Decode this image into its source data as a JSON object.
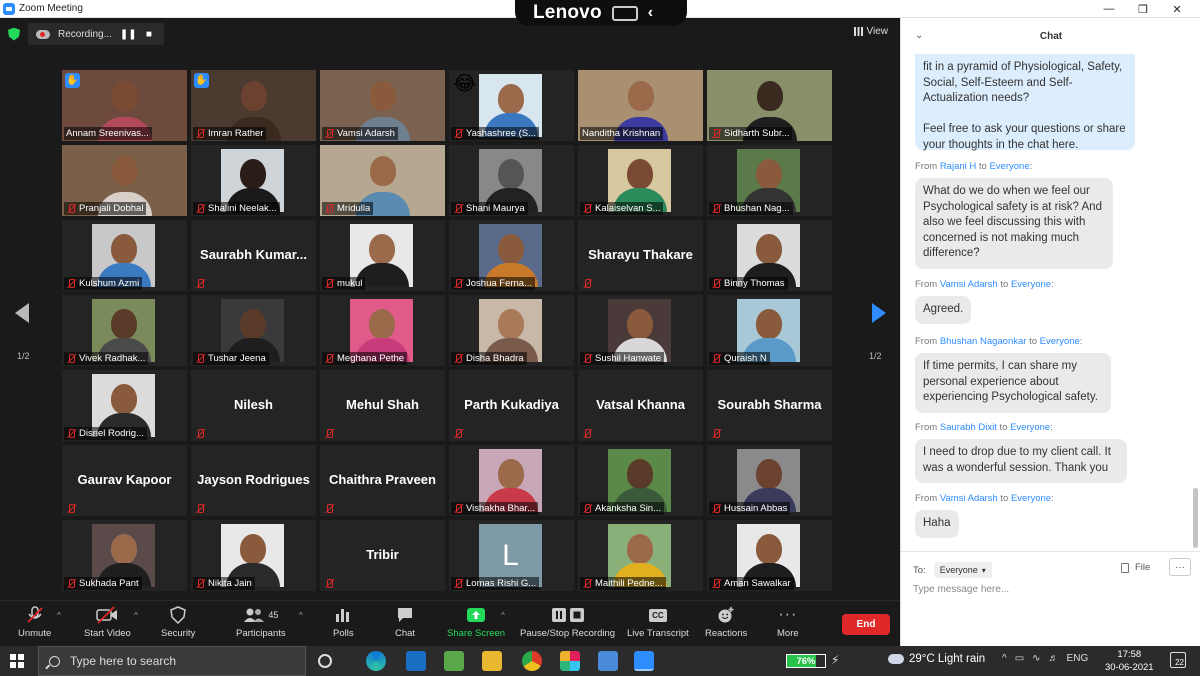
{
  "window": {
    "title": "Zoom Meeting"
  },
  "overlay": {
    "brand": "Lenovo"
  },
  "recording": {
    "label": "Recording..."
  },
  "view_label": "View",
  "pager": {
    "left": "1/2",
    "right": "1/2"
  },
  "participants": [
    {
      "name": "Annam Sreenivas...",
      "type": "video",
      "hand": true,
      "skin": "#7a4b33",
      "shirt": "#b34a5a",
      "bg": "#6d4a3c"
    },
    {
      "name": "Imran Rather",
      "type": "video",
      "hand": true,
      "muted": true,
      "skin": "#6b4230",
      "shirt": "#3a2a20",
      "bg": "#4b3a30"
    },
    {
      "name": "Vamsi Adarsh",
      "type": "video",
      "muted": true,
      "skin": "#8a5a3c",
      "shirt": "#6f7f8f",
      "bg": "#7b6250"
    },
    {
      "name": "Yashashree (S...",
      "type": "box",
      "emoji": "😂",
      "muted": true,
      "skin": "#9a6a4a",
      "shirt": "#3c78c0",
      "bg": "#d8e6f0"
    },
    {
      "name": "Nanditha Krishnan",
      "type": "video",
      "active": true,
      "skin": "#9a6a4a",
      "shirt": "#3c3ca0",
      "bg": "#a89070"
    },
    {
      "name": "Sidharth Subr...",
      "type": "video",
      "muted": true,
      "skin": "#3a2a20",
      "shirt": "#1e1e1e",
      "bg": "#88906a"
    },
    {
      "name": "Pranjali Dobhal",
      "type": "video",
      "muted": true,
      "skin": "#8a5a3c",
      "shirt": "#d8d0c8",
      "bg": "#7a6048"
    },
    {
      "name": "Shalini Neelak...",
      "type": "box",
      "muted": true,
      "skin": "#2a1c16",
      "shirt": "#1a1a1a",
      "bg": "#cfd4d8"
    },
    {
      "name": "Mridulla",
      "type": "video",
      "muted": true,
      "skin": "#9a6a4a",
      "shirt": "#5a8ab0",
      "bg": "#b6a890"
    },
    {
      "name": "Shani Maurya",
      "type": "box",
      "muted": true,
      "skin": "#555555",
      "shirt": "#222222",
      "bg": "#888888"
    },
    {
      "name": "Kalaiselvan S...",
      "type": "box",
      "muted": true,
      "skin": "#7a4b33",
      "shirt": "#2a8c5a",
      "bg": "#d8c8a0"
    },
    {
      "name": "Bhushan Nag...",
      "type": "box",
      "muted": true,
      "skin": "#8a5a3c",
      "shirt": "#333333",
      "bg": "#5a7a4a"
    },
    {
      "name": "Kulshum Azmi",
      "type": "box",
      "muted": true,
      "skin": "#8a5a3c",
      "shirt": "#3a7ac0",
      "bg": "#c8c8c8"
    },
    {
      "name": "Saurabh Kumar...",
      "type": "text"
    },
    {
      "name": "mukul",
      "type": "box",
      "muted": true,
      "skin": "#9a6a4a",
      "shirt": "#1e1e1e",
      "bg": "#e8e8e8"
    },
    {
      "name": "Joshua Ferna...",
      "type": "box",
      "muted": true,
      "skin": "#8a5a3c",
      "shirt": "#c87a2a",
      "bg": "#5a6a8a"
    },
    {
      "name": "Sharayu Thakare",
      "type": "text"
    },
    {
      "name": "Binny Thomas",
      "type": "box",
      "muted": true,
      "skin": "#8a5a3c",
      "shirt": "#1e1e1e",
      "bg": "#dcdcdc"
    },
    {
      "name": "Vivek Radhak...",
      "type": "box",
      "muted": true,
      "skin": "#5a3a28",
      "shirt": "#4a4a4a",
      "bg": "#7a8a5a"
    },
    {
      "name": "Tushar Jeena",
      "type": "box",
      "muted": true,
      "skin": "#5a3a28",
      "shirt": "#1e1e1e",
      "bg": "#3a3a3a"
    },
    {
      "name": "Meghana Pethe",
      "type": "box",
      "muted": true,
      "skin": "#9a6a4a",
      "shirt": "#c83a7a",
      "bg": "#e05a8a"
    },
    {
      "name": "Disha Bhadra",
      "type": "box",
      "muted": true,
      "skin": "#a87a5a",
      "shirt": "#7a5a4a",
      "bg": "#c8b8a8"
    },
    {
      "name": "Sushil Hanwate",
      "type": "box",
      "muted": true,
      "skin": "#8a5a3c",
      "shirt": "#d8d8d8",
      "bg": "#4a3a3a"
    },
    {
      "name": "Quraish N",
      "type": "box",
      "muted": true,
      "skin": "#8a5a3c",
      "shirt": "#5a9ac8",
      "bg": "#a8c8d8"
    },
    {
      "name": "Disnel Rodrig...",
      "type": "box",
      "muted": true,
      "skin": "#8a5a3c",
      "shirt": "#2a2a2a",
      "bg": "#dcdcdc"
    },
    {
      "name": "Nilesh",
      "type": "text"
    },
    {
      "name": "Mehul Shah",
      "type": "text"
    },
    {
      "name": "Parth Kukadiya",
      "type": "text"
    },
    {
      "name": "Vatsal Khanna",
      "type": "text"
    },
    {
      "name": "Sourabh Sharma",
      "type": "text"
    },
    {
      "name": "Gaurav Kapoor",
      "type": "text"
    },
    {
      "name": "Jayson Rodrigues",
      "type": "text"
    },
    {
      "name": "Chaithra Praveen",
      "type": "text"
    },
    {
      "name": "Vishakha Bhar...",
      "type": "box",
      "muted": true,
      "skin": "#9a6a4a",
      "shirt": "#c83a4a",
      "bg": "#c8a8b8"
    },
    {
      "name": "Akanksha Sin...",
      "type": "box",
      "muted": true,
      "skin": "#5a3a28",
      "shirt": "#3a5a3a",
      "bg": "#5a8a4a"
    },
    {
      "name": "Hussain Abbas",
      "type": "box",
      "muted": true,
      "skin": "#6b4230",
      "shirt": "#3a3a5a",
      "bg": "#8a8a8a"
    },
    {
      "name": "Sukhada Pant",
      "type": "box",
      "muted": true,
      "skin": "#9a6a4a",
      "shirt": "#1e1e1e",
      "bg": "#5a4a4a"
    },
    {
      "name": "Nikita Jain",
      "type": "box",
      "muted": true,
      "skin": "#8a5a3c",
      "shirt": "#2a2a2a",
      "bg": "#e8e8e8"
    },
    {
      "name": "Tribir",
      "type": "text"
    },
    {
      "name": "Lomas Rishi G...",
      "type": "letter",
      "letter": "L",
      "muted": true
    },
    {
      "name": "Maithili Pedne...",
      "type": "box",
      "muted": true,
      "skin": "#9a6a4a",
      "shirt": "#e0b020",
      "bg": "#8ab07a"
    },
    {
      "name": "Aman Sawalkar",
      "type": "box",
      "muted": true,
      "skin": "#8a5a3c",
      "shirt": "#1e1e1e",
      "bg": "#e8e8e8"
    }
  ],
  "toolbar": {
    "unmute": "Unmute",
    "start_video": "Start Video",
    "security": "Security",
    "participants": "Participants",
    "participants_count": "45",
    "polls": "Polls",
    "chat": "Chat",
    "share_screen": "Share Screen",
    "pause_stop_recording": "Pause/Stop Recording",
    "live_transcript": "Live Transcript",
    "live_transcript_icon_text": "CC",
    "reactions": "Reactions",
    "more": "More",
    "end": "End"
  },
  "chat": {
    "title": "Chat",
    "messages": [
      {
        "mine": true,
        "text": "fit in a pyramid of Physiological, Safety, Social, Self-Esteem and Self-Actualization needs?\n\nFeel free to ask your questions or share your thoughts in the chat here."
      },
      {
        "from_label": "From",
        "sender": "Rajani H",
        "to_label": "to",
        "recipient": "Everyone",
        "text": "What do we do when we feel our Psychological safety is at risk? And also we feel discussing this with concerned is not making much difference?"
      },
      {
        "from_label": "From",
        "sender": "Vamsi Adarsh",
        "to_label": "to",
        "recipient": "Everyone",
        "text": "Agreed."
      },
      {
        "from_label": "From",
        "sender": "Bhushan Nagaonkar",
        "to_label": "to",
        "recipient": "Everyone",
        "text": "If time permits, I can share my personal experience about experiencing Psychological safety."
      },
      {
        "from_label": "From",
        "sender": "Saurabh Dixit",
        "to_label": "to",
        "recipient": "Everyone",
        "text": "I need to drop due to my client call. It was a wonderful session. Thank you"
      },
      {
        "from_label": "From",
        "sender": "Vamsi Adarsh",
        "to_label": "to",
        "recipient": "Everyone",
        "text": "Haha"
      }
    ],
    "to_label": "To:",
    "to_value": "Everyone",
    "file_label": "File",
    "input_placeholder": "Type message here..."
  },
  "taskbar": {
    "search_placeholder": "Type here to search",
    "battery": "76%",
    "battery_level": 0.76,
    "weather": "29°C  Light rain",
    "lang": "ENG",
    "time": "17:58",
    "date": "30-06-2021",
    "notifications": "22"
  }
}
